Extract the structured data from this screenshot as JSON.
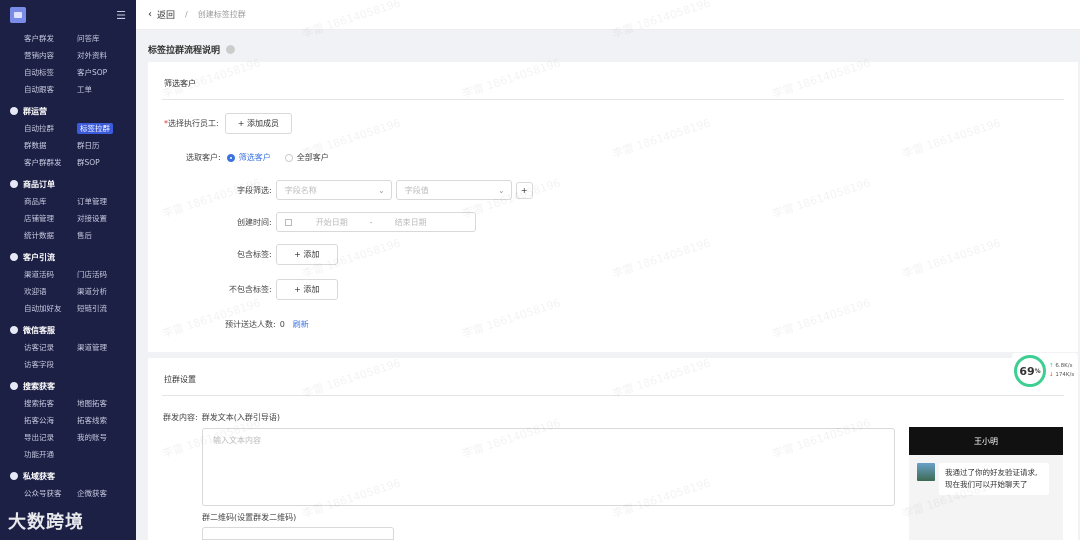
{
  "sidebar": {
    "groups": [
      {
        "title": "",
        "items": [
          "客户群发",
          "问答库",
          "营销内容",
          "对外资料",
          "自动标签",
          "客户SOP",
          "自动跟客",
          "工单"
        ]
      },
      {
        "title": "群运营",
        "items": [
          "自动拉群",
          "标签拉群",
          "群数据",
          "群日历",
          "客户群群发",
          "群SOP"
        ]
      },
      {
        "title": "商品订单",
        "items": [
          "商品库",
          "订单管理",
          "店铺管理",
          "对接设置",
          "统计数据",
          "售后"
        ]
      },
      {
        "title": "客户引流",
        "items": [
          "渠道活码",
          "门店活码",
          "欢迎语",
          "渠道分析",
          "自动加好友",
          "短链引流"
        ]
      },
      {
        "title": "微信客服",
        "items": [
          "访客记录",
          "渠道管理",
          "访客字段"
        ]
      },
      {
        "title": "搜索获客",
        "items": [
          "搜索拓客",
          "地图拓客",
          "拓客公海",
          "拓客线索",
          "导出记录",
          "我的账号",
          "功能开通"
        ]
      },
      {
        "title": "私域获客",
        "items": [
          "公众号获客",
          "企微获客"
        ]
      }
    ],
    "active_item": "标签拉群",
    "watermark": "大数跨境"
  },
  "topbar": {
    "back_label": "返回",
    "separator": "/",
    "breadcrumb": "创建标签拉群"
  },
  "section_title": "标签拉群流程说明",
  "filter_card": {
    "heading": "筛选客户",
    "staff_label": "选择执行员工:",
    "add_member_button": "+ 添加成员",
    "select_customer_label": "选取客户:",
    "radio_filter": "筛选客户",
    "radio_all": "全部客户",
    "field_filter_label": "字段筛选:",
    "field_name_placeholder": "字段名称",
    "field_value_placeholder": "字段值",
    "field_add": "+",
    "created_time_label": "创建时间:",
    "start_date_placeholder": "开始日期",
    "date_separator": "-",
    "end_date_placeholder": "结束日期",
    "include_tags_label": "包含标签:",
    "include_tags_button": "+ 添加",
    "exclude_tags_label": "不包含标签:",
    "exclude_tags_button": "+ 添加",
    "estimate_label": "预计送达人数:",
    "estimate_value": "0",
    "refresh_link": "刷新"
  },
  "group_card": {
    "heading": "拉群设置",
    "content_label": "群发内容:",
    "content_sublabel": "群发文本(入群引导语)",
    "textarea_placeholder": "输入文本内容",
    "qr_label": "群二维码(设置群发二维码)"
  },
  "preview": {
    "contact_name": "王小明",
    "message": "我通过了你的好友验证请求,现在我们可以开始聊天了"
  },
  "speed_widget": {
    "percent": "69",
    "percent_unit": "%",
    "upload": "6.8K/s",
    "download": "174K/s"
  },
  "watermark_text": "李雷 18614058196",
  "colors": {
    "sidebar_bg": "#1d2045",
    "accent": "#3b72e0",
    "active_tag": "#3b5bdb"
  }
}
